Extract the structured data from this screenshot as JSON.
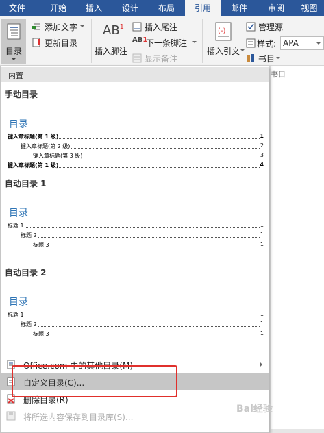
{
  "tabs": [
    "文件",
    "开始",
    "插入",
    "设计",
    "布局",
    "引用",
    "邮件",
    "审阅",
    "视图"
  ],
  "ribbon": {
    "toc_button": "目录",
    "add_text": "添加文字",
    "update_toc": "更新目录",
    "insert_footnote": "插入脚注",
    "insert_endnote": "插入尾注",
    "next_footnote": "下一条脚注",
    "show_notes": "显示备注",
    "insert_citation": "插入引文",
    "manage_sources": "管理源",
    "style_label": "样式:",
    "style_value": "APA",
    "bibliography": "书目",
    "group_bibliography_partial": "书目"
  },
  "dropdown": {
    "header": "内置",
    "sections": [
      {
        "title": "手动目录",
        "toc_heading": "目录",
        "lines": [
          {
            "text": "键入章标题(第 1 级)",
            "page": "1"
          },
          {
            "text": "键入章标题(第 2 级)",
            "page": "2"
          },
          {
            "text": "键入章标题(第 3 级)",
            "page": "3"
          },
          {
            "text": "键入章标题(第 1 级)",
            "page": "4"
          }
        ]
      },
      {
        "title": "自动目录 1",
        "toc_heading": "目录",
        "lines": [
          {
            "text": "标题 1",
            "page": "1"
          },
          {
            "text": "标题 2",
            "page": "1"
          },
          {
            "text": "标题 3",
            "page": "1"
          }
        ]
      },
      {
        "title": "自动目录 2",
        "toc_heading": "目录",
        "lines": [
          {
            "text": "标题 1",
            "page": "1"
          },
          {
            "text": "标题 2",
            "page": "1"
          },
          {
            "text": "标题 3",
            "page": "1"
          }
        ]
      }
    ],
    "menu": {
      "more_toc": "Office.com 中的其他目录(M)",
      "custom_toc": "自定义目录(C)...",
      "remove_toc": "删除目录(R)",
      "save_selection": "将所选内容保存到目录库(S)..."
    }
  },
  "watermark": "Bai经验"
}
